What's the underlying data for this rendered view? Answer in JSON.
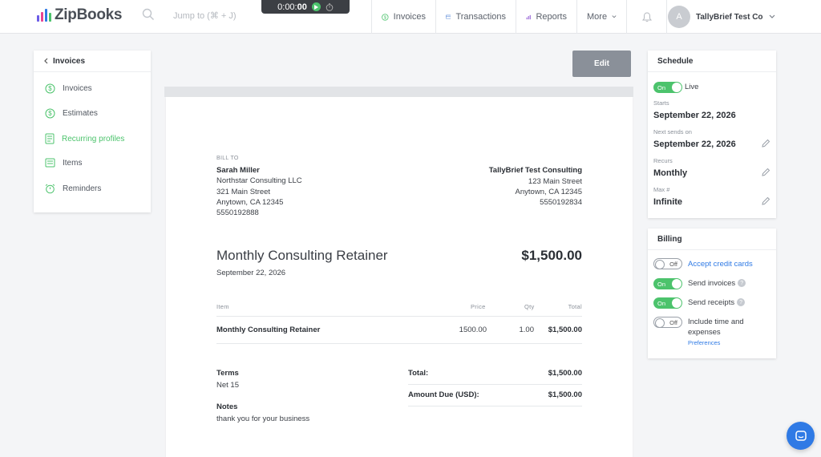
{
  "brand": {
    "name": "ZipBooks",
    "accent": "#4cc36c",
    "link": "#2f7ae5"
  },
  "search": {
    "placeholder": "Jump to (⌘ + J)"
  },
  "timer": {
    "time_prefix": "0:00:",
    "time_bold": "00"
  },
  "nav": {
    "invoices": "Invoices",
    "transactions": "Transactions",
    "reports": "Reports",
    "more": "More"
  },
  "account": {
    "initial": "A",
    "name": "TallyBrief Test Co"
  },
  "sidebar": {
    "back_label": "Invoices",
    "items": [
      {
        "label": "Invoices",
        "icon": "dollar-circle-icon"
      },
      {
        "label": "Estimates",
        "icon": "dollar-circle-icon"
      },
      {
        "label": "Recurring profiles",
        "icon": "recurring-doc-icon"
      },
      {
        "label": "Items",
        "icon": "list-icon"
      },
      {
        "label": "Reminders",
        "icon": "alarm-icon"
      }
    ]
  },
  "toolbar": {
    "edit_label": "Edit"
  },
  "invoice": {
    "bill_to_label": "BILL TO",
    "client": {
      "name": "Sarah Miller",
      "company": "Northstar Consulting LLC",
      "street": "321 Main Street",
      "city": "Anytown, CA 12345",
      "phone": "5550192888"
    },
    "sender": {
      "name": "TallyBrief Test Consulting",
      "street": "123 Main Street",
      "city": "Anytown, CA 12345",
      "phone": "5550192834"
    },
    "title": "Monthly Consulting Retainer",
    "amount": "$1,500.00",
    "date": "September 22, 2026",
    "columns": {
      "item": "Item",
      "price": "Price",
      "qty": "Qty",
      "total": "Total"
    },
    "lines": [
      {
        "item": "Monthly Consulting Retainer",
        "price": "1500.00",
        "qty": "1.00",
        "total": "$1,500.00"
      }
    ],
    "terms_label": "Terms",
    "terms_value": "Net 15",
    "notes_label": "Notes",
    "notes_value": "thank you for your business",
    "total_label": "Total:",
    "total_value": "$1,500.00",
    "due_label": "Amount Due (USD):",
    "due_value": "$1,500.00"
  },
  "schedule": {
    "title": "Schedule",
    "live_toggle": "On",
    "live_label": "Live",
    "starts_label": "Starts",
    "starts_value": "September 22, 2026",
    "next_label": "Next sends on",
    "next_value": "September 22, 2026",
    "recurs_label": "Recurs",
    "recurs_value": "Monthly",
    "max_label": "Max #",
    "max_value": "Infinite"
  },
  "billing": {
    "title": "Billing",
    "credit_toggle": "Off",
    "credit_label": "Accept credit cards",
    "send_invoices_toggle": "On",
    "send_invoices_label": "Send invoices",
    "send_receipts_toggle": "On",
    "send_receipts_label": "Send receipts",
    "time_toggle": "Off",
    "time_label": "Include time and expenses",
    "preferences_link": "Preferences"
  }
}
